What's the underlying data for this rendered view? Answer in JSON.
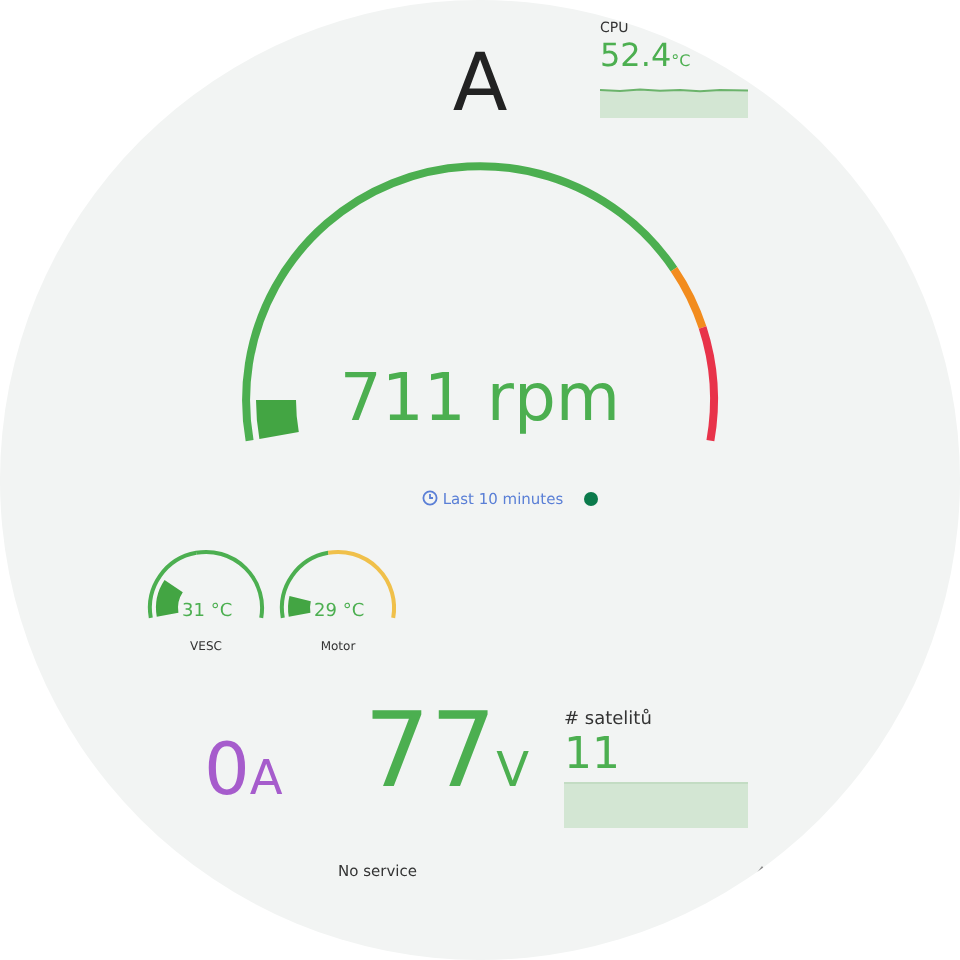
{
  "title": "A",
  "cpu_card": {
    "label": "CPU",
    "value": "52.4",
    "unit": "°C"
  },
  "rpm_gauge": {
    "value": "711 rpm",
    "time_range": "Last 10 minutes"
  },
  "temperature_gauges": [
    {
      "value": "31 °C",
      "label": "VESC"
    },
    {
      "value": "29 °C",
      "label": "Motor"
    }
  ],
  "current": {
    "value": "0",
    "unit": "A"
  },
  "voltage": {
    "value": "77",
    "unit": "V"
  },
  "satellites_card": {
    "label": "# satelitů",
    "value": "11"
  },
  "status": "No service"
}
